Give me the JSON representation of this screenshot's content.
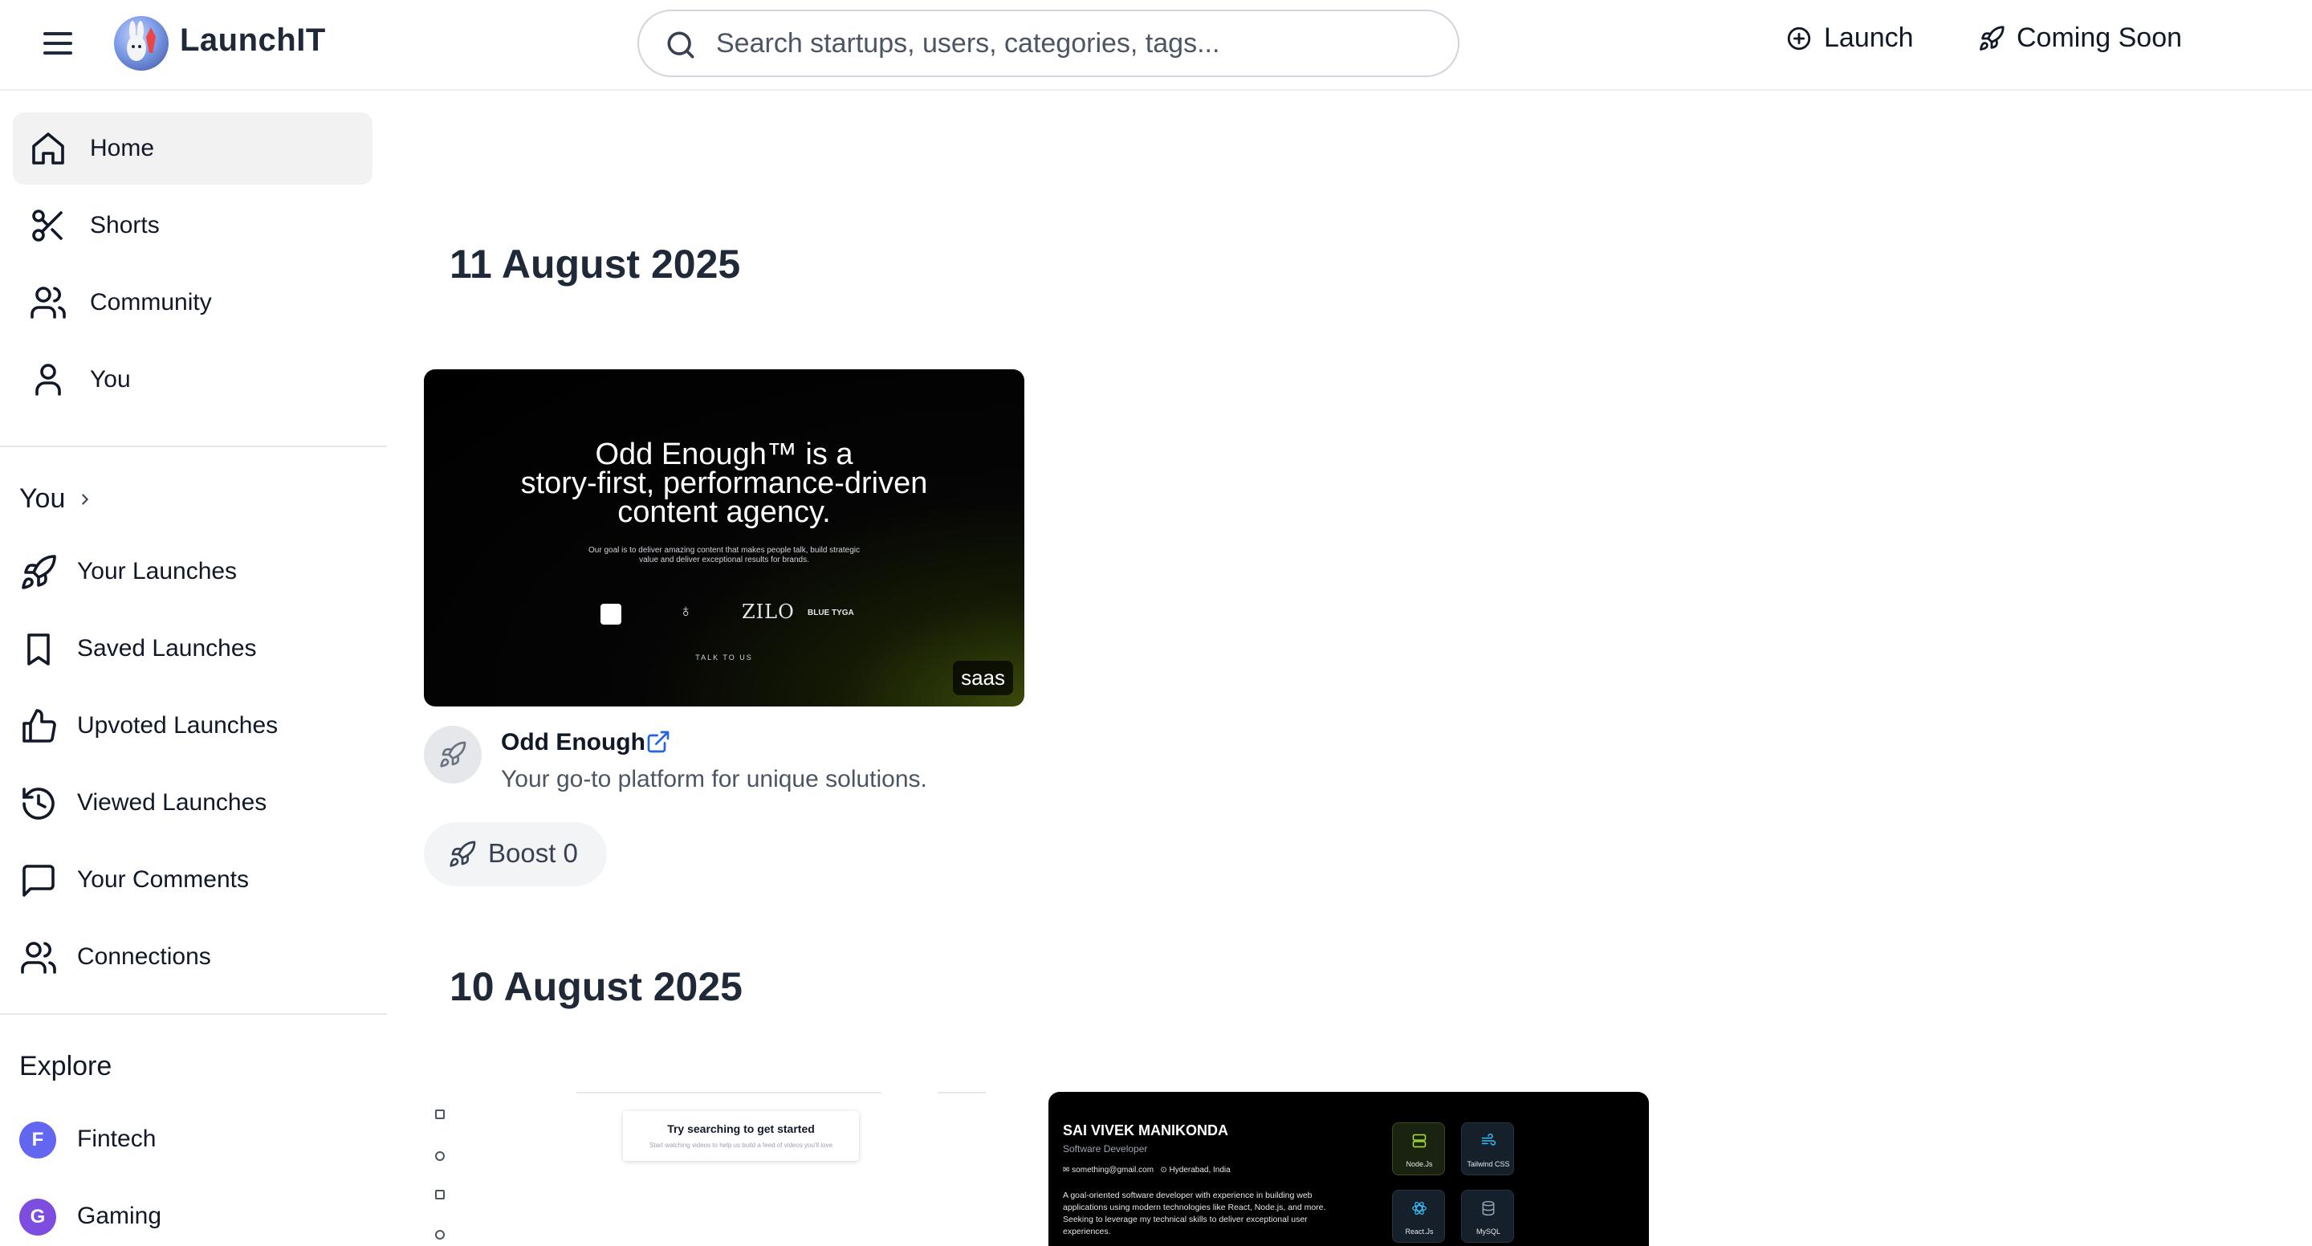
{
  "header": {
    "brand": "LaunchIT",
    "search_placeholder": "Search startups, users, categories, tags...",
    "launch_label": "Launch",
    "coming_soon_label": "Coming Soon"
  },
  "sidebar": {
    "main_nav": [
      {
        "label": "Home",
        "icon": "home-icon",
        "active": true
      },
      {
        "label": "Shorts",
        "icon": "scissors-icon"
      },
      {
        "label": "Community",
        "icon": "users-icon"
      },
      {
        "label": "You",
        "icon": "user-icon"
      }
    ],
    "you_section_title": "You",
    "you_items": [
      {
        "label": "Your Launches",
        "icon": "rocket-icon"
      },
      {
        "label": "Saved Launches",
        "icon": "bookmark-icon"
      },
      {
        "label": "Upvoted Launches",
        "icon": "thumbs-up-icon"
      },
      {
        "label": "Viewed Launches",
        "icon": "history-icon"
      },
      {
        "label": "Your Comments",
        "icon": "comment-icon"
      },
      {
        "label": "Connections",
        "icon": "users-icon"
      }
    ],
    "explore_title": "Explore",
    "explore_items": [
      {
        "label": "Fintech",
        "letter": "F",
        "color": "#6366f1"
      },
      {
        "label": "Gaming",
        "letter": "G",
        "color": "#7c4dde"
      }
    ]
  },
  "feed": {
    "groups": [
      {
        "date": "11 August 2025",
        "launch": {
          "name": "Odd Enough",
          "description": "Your go-to platform for unique solutions.",
          "tag": "saas",
          "boost_label": "Boost 0",
          "thumbnail": {
            "headline_lines": [
              "Odd Enough™ is a",
              "story-first, performance-driven",
              "content agency."
            ],
            "subtext_lines": [
              "Our goal is to deliver amazing content that makes people talk, build strategic",
              "value and deliver exceptional results for brands."
            ],
            "logo_texts": [
              "ZILO",
              "BLUE TYGA"
            ],
            "cta": "TALK TO US"
          }
        }
      },
      {
        "date": "10 August 2025",
        "thumbnails": [
          {
            "title": "Try searching to get started",
            "subtitle": "Start watching videos to help us build a feed of videos you'll love"
          },
          {
            "name": "SAI VIVEK MANIKONDA",
            "role": "Software Developer",
            "email": "something@gmail.com",
            "location": "Hyderabad, India",
            "bio": "A goal-oriented software developer with experience in building web applications using modern technologies like React, Node.js, and more. Seeking to leverage my technical skills to deliver exceptional user experiences.",
            "skills": [
              "Node.Js",
              "Tailwind CSS",
              "React.Js",
              "MySQL"
            ]
          }
        ]
      }
    ]
  },
  "colors": {
    "accent_link": "#2563eb",
    "active_nav_bg": "#f2f2f2"
  }
}
